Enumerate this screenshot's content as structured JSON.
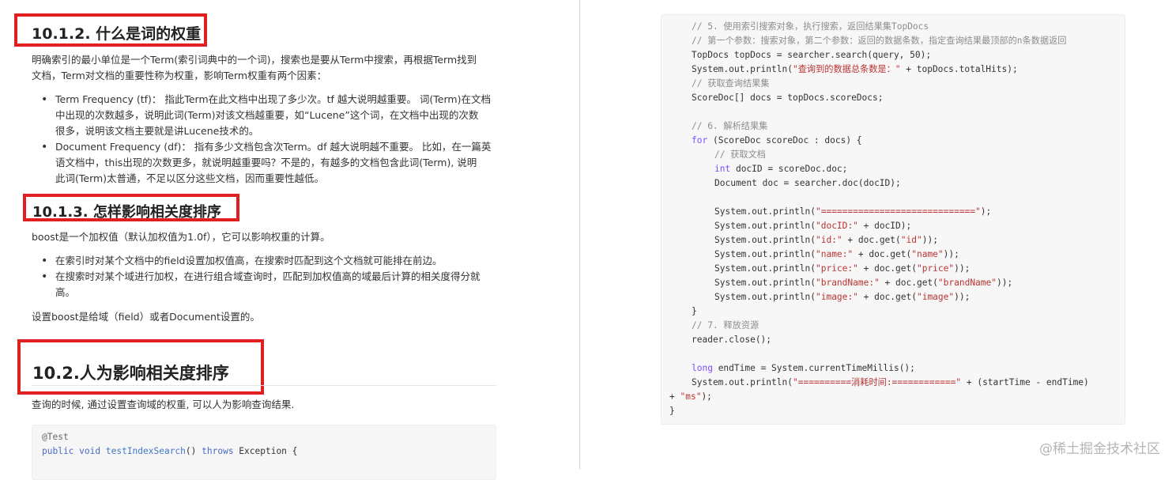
{
  "left": {
    "h1": "10.1.2. 什么是词的权重",
    "p1_line1": "明确索引的最小单位是一个Term(索引词典中的一个词)，搜索也是要从Term中搜索，再根据Term找到",
    "p1_line2": "文档，Term对文档的重要性称为权重，影响Term权重有两个因素：",
    "bullets1": [
      {
        "l1": "Term Frequency (tf)： 指此Term在此文档中出现了多少次。tf 越大说明越重要。 词(Term)在文档",
        "l2": "中出现的次数越多，说明此词(Term)对该文档越重要，如“Lucene”这个词，在文档中出现的次数",
        "l3": "很多，说明该文档主要就是讲Lucene技术的。"
      },
      {
        "l1": "Document Frequency (df)： 指有多少文档包含次Term。df 越大说明越不重要。 比如，在一篇英",
        "l2": "语文档中，this出现的次数更多，就说明越重要吗？不是的，有越多的文档包含此词(Term), 说明",
        "l3": "此词(Term)太普通，不足以区分这些文档，因而重要性越低。"
      }
    ],
    "h2": "10.1.3. 怎样影响相关度排序",
    "p2": "boost是一个加权值（默认加权值为1.0f），它可以影响权重的计算。",
    "bullets2": [
      {
        "l1": "在索引时对某个文档中的field设置加权值高，在搜索时匹配到这个文档就可能排在前边。"
      },
      {
        "l1": "在搜索时对某个域进行加权，在进行组合域查询时，匹配到加权值高的域最后计算的相关度得分就",
        "l2": "高。"
      }
    ],
    "p3": "设置boost是给域（field）或者Document设置的。",
    "h3": "10.2.人为影响相关度排序",
    "p4": "查询的时候, 通过设置查询域的权重, 可以人为影响查询结果.",
    "code": {
      "annotation": "@Test",
      "kw_public": "public",
      "kw_void": "void",
      "method": "testIndexSearch",
      "after_method": "() ",
      "kw_throws": "throws",
      "rest": " Exception {"
    }
  },
  "right": {
    "code": {
      "c1": "// 5. 使用索引搜索对象，执行搜索，返回结果集TopDocs",
      "c2": "// 第一个参数：搜索对象，第二个参数：返回的数据条数，指定查询结果最顶部的n条数据返回",
      "l3": "TopDocs topDocs = searcher.search(query, 50);",
      "l4a": "System.out.println(",
      "l4s": "\"查询到的数据总条数是：\"",
      "l4b": " + topDocs.totalHits);",
      "c5": "// 获取查询结果集",
      "l6": "ScoreDoc[] docs = topDocs.scoreDocs;",
      "c7": "// 6. 解析结果集",
      "l8kw": "for",
      "l8": " (ScoreDoc scoreDoc : docs) {",
      "c9": "// 获取文档",
      "l10kw": "int",
      "l10": " docID = scoreDoc.doc;",
      "l11": "Document doc = searcher.doc(docID);",
      "p_prefix": "System.out.println(",
      "s1": "\"=============================\"",
      "s1_end": ");",
      "s2": "\"docID:\"",
      "s2_end": " + docID);",
      "s3": "\"id:\"",
      "s3_mid": " + doc.get(",
      "s3v": "\"id\"",
      "s3_end": "));",
      "s4": "\"name:\"",
      "s4v": "\"name\"",
      "s5": "\"price:\"",
      "s5v": "\"price\"",
      "s6": "\"brandName:\"",
      "s6v": "\"brandName\"",
      "s7": "\"image:\"",
      "s7v": "\"image\"",
      "close_brace": "}",
      "c8": "// 7. 释放资源",
      "l_close": "reader.close();",
      "long_kw": "long",
      "long_rest": " endTime = System.currentTimeMillis();",
      "last_a": "System.out.println(",
      "last_s": "\"==========消耗时间:============\"",
      "last_b": " + (startTime - endTime)",
      "last2_a": "+ ",
      "last2_s": "\"ms\"",
      "last2_b": ");",
      "final_brace": "}"
    },
    "watermark": "@稀土掘金技术社区"
  }
}
